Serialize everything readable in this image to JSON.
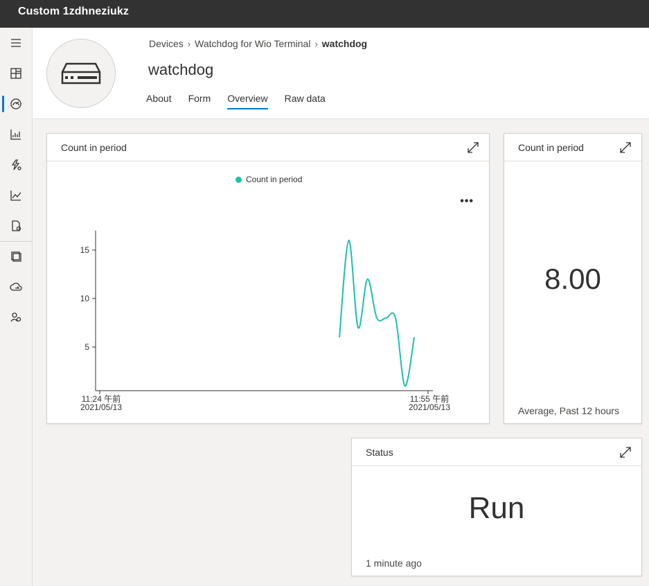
{
  "app": {
    "title": "Custom 1zdhneziukz"
  },
  "nav": {
    "items": [
      {
        "name": "menu-icon"
      },
      {
        "name": "dashboard-icon"
      },
      {
        "name": "devices-icon",
        "active": true
      },
      {
        "name": "analytics-icon"
      },
      {
        "name": "rules-icon"
      },
      {
        "name": "jobs-icon"
      },
      {
        "name": "device-templates-icon"
      },
      {
        "name": "device-groups-icon"
      },
      {
        "name": "data-export-icon"
      },
      {
        "name": "administration-icon"
      }
    ]
  },
  "header": {
    "breadcrumb": [
      "Devices",
      "Watchdog for Wio Terminal",
      "watchdog"
    ],
    "title": "watchdog",
    "tabs": [
      {
        "label": "About",
        "active": false
      },
      {
        "label": "Form",
        "active": false
      },
      {
        "label": "Overview",
        "active": true
      },
      {
        "label": "Raw data",
        "active": false
      }
    ]
  },
  "tiles": {
    "chart_tile": {
      "title": "Count in period",
      "legend": "Count in period"
    },
    "kpi_tile": {
      "title": "Count in period",
      "value": "8.00",
      "caption": "Average, Past 12 hours"
    },
    "status_tile": {
      "title": "Status",
      "value": "Run",
      "caption": "1 minute ago"
    }
  },
  "colors": {
    "series": "#1ebfae",
    "accent": "#0078d4"
  },
  "chart_data": {
    "type": "line",
    "series": [
      {
        "name": "Count in period",
        "points": [
          {
            "x": 0.0,
            "y": 6
          },
          {
            "x": 0.2,
            "y": 16
          },
          {
            "x": 0.4,
            "y": 7
          },
          {
            "x": 0.6,
            "y": 12
          },
          {
            "x": 0.8,
            "y": 8
          },
          {
            "x": 1.0,
            "y": 8
          },
          {
            "x": 1.2,
            "y": 8
          },
          {
            "x": 1.4,
            "y": 1
          },
          {
            "x": 1.6,
            "y": 6
          }
        ]
      }
    ],
    "x_ticks": [
      {
        "label_time": "11:24 午前",
        "label_date": "2021/05/13"
      },
      {
        "label_time": "11:55 午前",
        "label_date": "2021/05/13"
      }
    ],
    "y_ticks": [
      5,
      10,
      15
    ],
    "ylim": [
      0.5,
      17
    ]
  }
}
